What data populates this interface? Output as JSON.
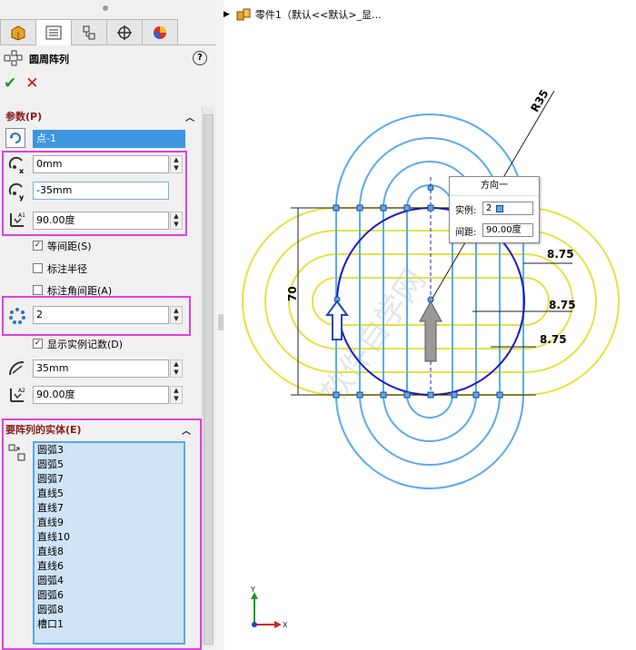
{
  "tree": {
    "label": "零件1（默认<<默认>_显..."
  },
  "panel": {
    "title": "圆周阵列",
    "help": "?",
    "ok": "✔",
    "cancel": "✕",
    "params_header": "参数(P)",
    "point_field": "点-1",
    "x_value": "0mm",
    "y_value": "-35mm",
    "angle1": "90.00度",
    "equal_spacing": "等间距(S)",
    "dim_radius": "标注半径",
    "dim_angle_spacing": "标注角间距(A)",
    "instance_count": "2",
    "show_instance": "显示实例记数(D)",
    "radius_value": "35mm",
    "angle2": "90.00度",
    "entities_header": "要阵列的实体(E)",
    "entities": [
      "圆弧3",
      "圆弧5",
      "圆弧7",
      "直线5",
      "直线7",
      "直线9",
      "直线10",
      "直线8",
      "直线6",
      "圆弧4",
      "圆弧6",
      "圆弧8",
      "槽口1"
    ]
  },
  "callout": {
    "title": "方向一",
    "instances_label": "实例:",
    "instances_value": "2",
    "spacing_label": "间距:",
    "spacing_value": "90.00度"
  },
  "dims": {
    "r": "R35",
    "d1": "8.75",
    "d2": "8.75",
    "d3": "8.75",
    "h": "70"
  },
  "triad": {
    "x": "X",
    "y": "Y"
  },
  "colors": {
    "accent": "#3e96e0",
    "highlight": "#e040e0",
    "sketch_blue": "#5aaaf0",
    "sketch_yellow": "#e8e040",
    "circle": "#1a1ad0"
  }
}
